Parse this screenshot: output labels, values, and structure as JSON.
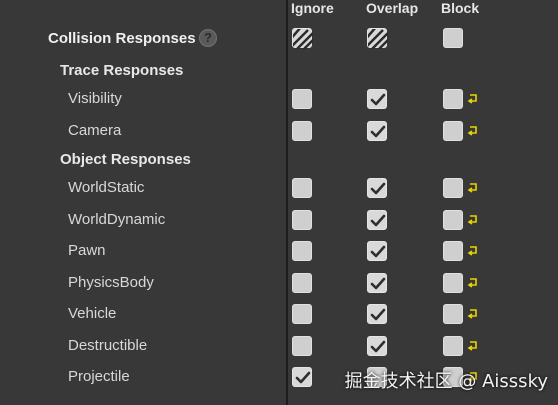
{
  "headers": {
    "ignore": "Ignore",
    "overlap": "Overlap",
    "block": "Block"
  },
  "collision": {
    "label": "Collision Responses",
    "help_icon": "question-icon"
  },
  "trace": {
    "label": "Trace Responses",
    "rows": [
      {
        "label": "Visibility",
        "ignore": false,
        "overlap": true,
        "block": false
      },
      {
        "label": "Camera",
        "ignore": false,
        "overlap": true,
        "block": false
      }
    ]
  },
  "object": {
    "label": "Object Responses",
    "rows": [
      {
        "label": "WorldStatic",
        "ignore": false,
        "overlap": true,
        "block": false
      },
      {
        "label": "WorldDynamic",
        "ignore": false,
        "overlap": true,
        "block": false
      },
      {
        "label": "Pawn",
        "ignore": false,
        "overlap": true,
        "block": false
      },
      {
        "label": "PhysicsBody",
        "ignore": false,
        "overlap": true,
        "block": false
      },
      {
        "label": "Vehicle",
        "ignore": false,
        "overlap": true,
        "block": false
      },
      {
        "label": "Destructible",
        "ignore": false,
        "overlap": true,
        "block": false
      },
      {
        "label": "Projectile",
        "ignore": true,
        "overlap": false,
        "block": false
      }
    ]
  },
  "watermark": "掘金技术社区 @ Aisssky",
  "colors": {
    "background": "#383838",
    "reset_arrow": "#e8d400",
    "divider": "#1c1c1c"
  }
}
